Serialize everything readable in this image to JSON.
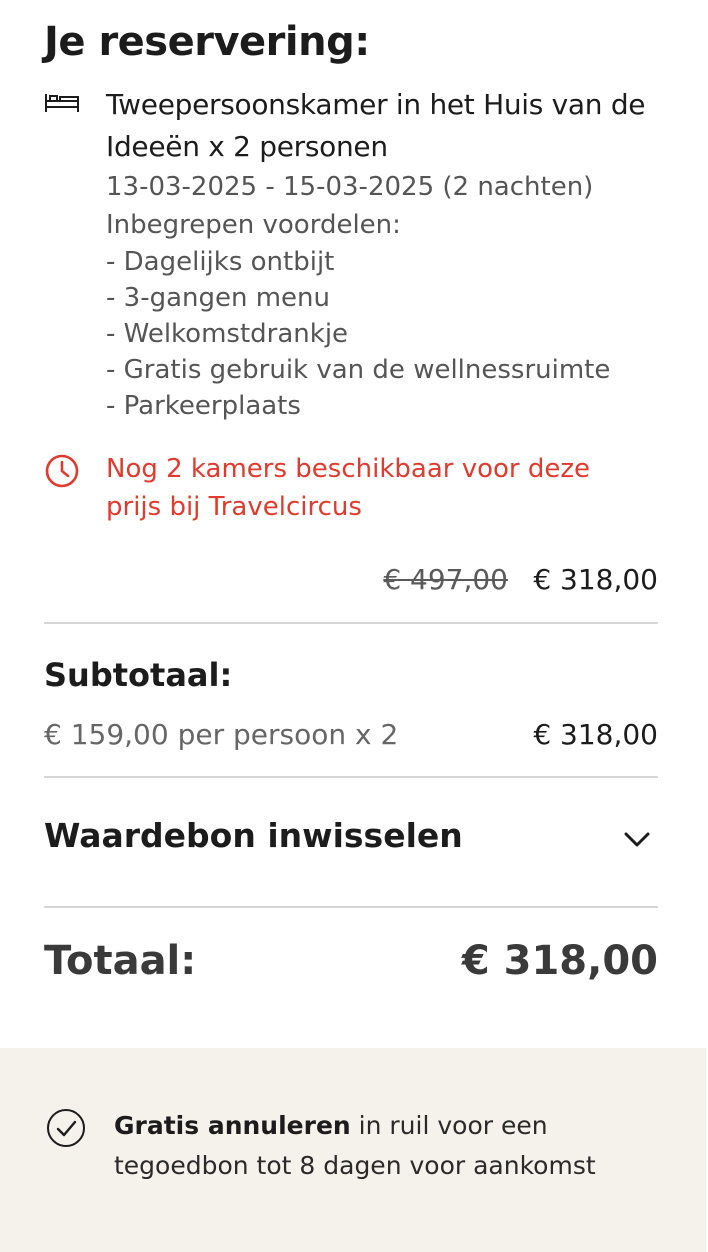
{
  "reservation": {
    "title": "Je reservering:",
    "room_name": "Tweepersoonskamer in het Huis van de Ideeën x 2 personen",
    "dates": "13-03-2025 - 15-03-2025 (2 nachten)",
    "benefits_title": "Inbegrepen voordelen:",
    "benefits": [
      "- Dagelijks ontbijt",
      "- 3-gangen menu",
      "- Welkomstdrankje",
      "- Gratis gebruik van de wellnessruimte",
      "- Parkeerplaats"
    ],
    "availability": "Nog 2 kamers beschikbaar voor deze prijs bij Travelcircus",
    "old_price": "€ 497,00",
    "new_price": "€ 318,00"
  },
  "subtotal": {
    "label": "Subtotaal:",
    "detail": "€ 159,00 per persoon x 2",
    "amount": "€ 318,00"
  },
  "voucher": {
    "label": "Waardebon inwisselen",
    "icon": "chevron-down-icon"
  },
  "total": {
    "label": "Totaal:",
    "amount": "€ 318,00"
  },
  "footer": {
    "bold": "Gratis annuleren",
    "text": " in ruil voor een tegoedbon tot 8 dagen voor aankomst",
    "icon": "check-circle-icon"
  },
  "colors": {
    "accent_red": "#e03b2e",
    "footer_bg": "#f5f2ec",
    "divider": "#d6d6d6"
  }
}
